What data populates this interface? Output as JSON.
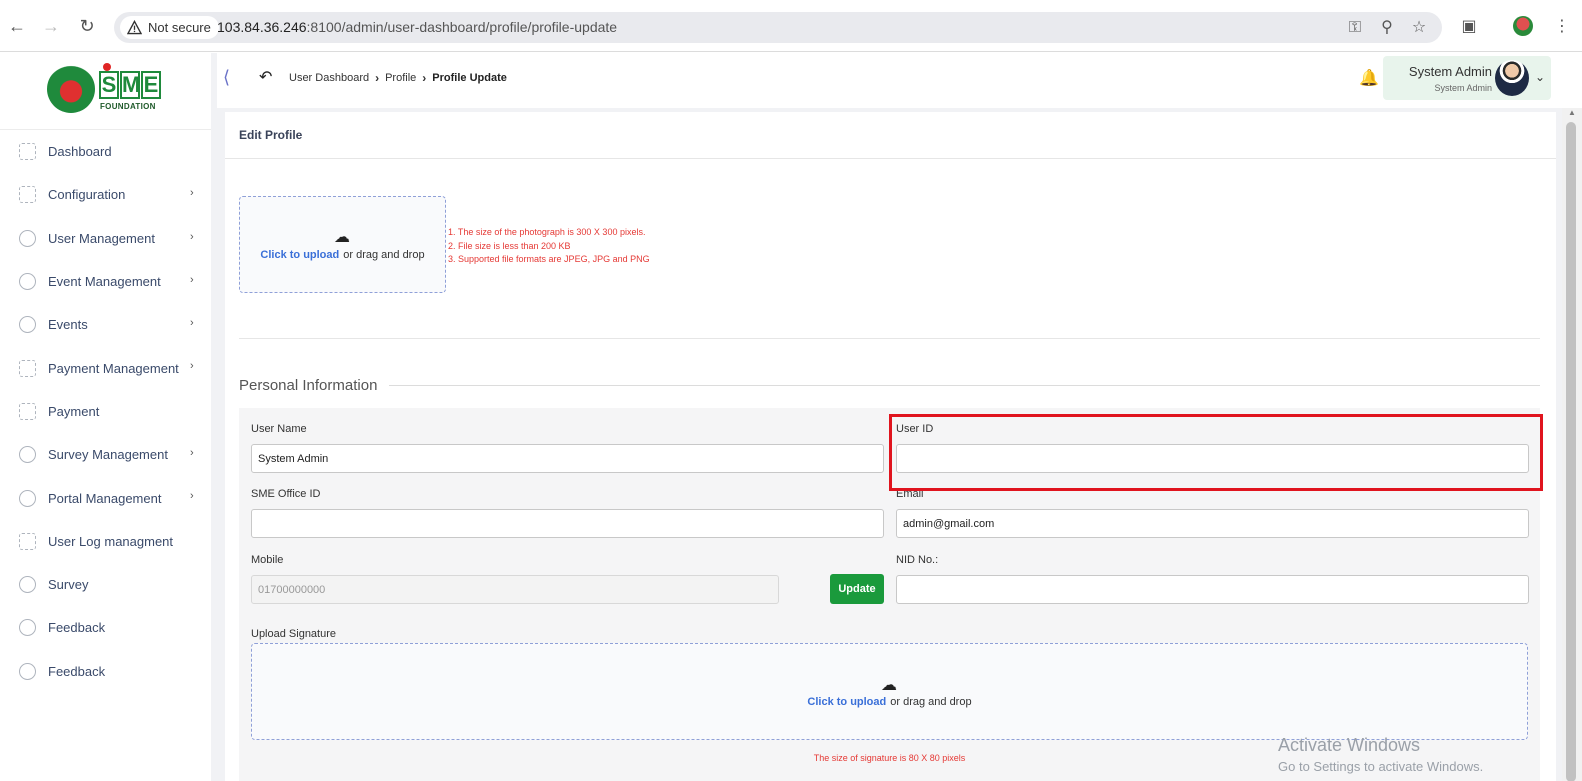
{
  "browser": {
    "security_label": "Not secure",
    "url_host": "103.84.36.246",
    "url_rest": ":8100/admin/user-dashboard/profile/profile-update"
  },
  "sidebar": {
    "logo_text": "SME",
    "logo_subtext": "FOUNDATION",
    "items": [
      {
        "label": "Dashboard",
        "icon": "grid-icon",
        "has_submenu": false
      },
      {
        "label": "Configuration",
        "icon": "settings-icon",
        "has_submenu": true
      },
      {
        "label": "User Management",
        "icon": "user-icon",
        "has_submenu": true
      },
      {
        "label": "Event Management",
        "icon": "lock-icon",
        "has_submenu": true
      },
      {
        "label": "Events",
        "icon": "lock-icon",
        "has_submenu": true
      },
      {
        "label": "Payment Management",
        "icon": "money-icon",
        "has_submenu": true
      },
      {
        "label": "Payment",
        "icon": "money-icon",
        "has_submenu": false
      },
      {
        "label": "Survey Management",
        "icon": "pie-icon",
        "has_submenu": true
      },
      {
        "label": "Portal Management",
        "icon": "lock-icon",
        "has_submenu": true
      },
      {
        "label": "User Log managment",
        "icon": "money-icon",
        "has_submenu": false
      },
      {
        "label": "Survey",
        "icon": "pie-icon",
        "has_submenu": false
      },
      {
        "label": "Feedback",
        "icon": "feedback-icon",
        "has_submenu": false
      },
      {
        "label": "Feedback",
        "icon": "feedback-icon",
        "has_submenu": false
      }
    ]
  },
  "header": {
    "breadcrumb": [
      "User Dashboard",
      "Profile",
      "Profile Update"
    ],
    "user_name": "System Admin",
    "user_role": "System Admin"
  },
  "card": {
    "title": "Edit Profile",
    "photo_upload": {
      "link": "Click to upload",
      "text": "or drag and drop",
      "rules": [
        "1. The size of the photograph is 300 X 300 pixels.",
        "2. File size is less than 200 KB",
        "3. Supported file formats are JPEG, JPG and PNG"
      ]
    },
    "section_title": "Personal Information",
    "fields": {
      "user_name": {
        "label": "User Name",
        "value": "System Admin"
      },
      "user_id": {
        "label": "User ID",
        "value": ""
      },
      "sme_office_id": {
        "label": "SME Office ID",
        "value": ""
      },
      "email": {
        "label": "Email",
        "value": "admin@gmail.com"
      },
      "mobile": {
        "label": "Mobile",
        "value": "01700000000"
      },
      "nid": {
        "label": "NID No.:",
        "value": ""
      }
    },
    "update_button": "Update",
    "signature": {
      "label": "Upload Signature",
      "link": "Click to upload",
      "text": "or drag and drop",
      "rule": "The size of signature is 80 X 80 pixels"
    }
  },
  "watermark": {
    "line1": "Activate Windows",
    "line2": "Go to Settings to activate Windows."
  },
  "colors": {
    "accent_green": "#1a9a3c",
    "link_blue": "#3a6fd8",
    "rule_red": "#e53935",
    "highlight_red": "#e0141e"
  }
}
